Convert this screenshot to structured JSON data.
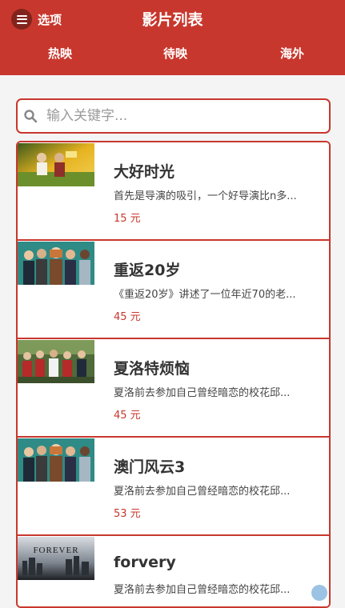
{
  "header": {
    "menu_label": "选项",
    "title": "影片列表",
    "tabs": [
      {
        "label": "热映"
      },
      {
        "label": "待映"
      },
      {
        "label": "海外"
      }
    ],
    "color": "#c8372d"
  },
  "search": {
    "placeholder": "输入关键字..."
  },
  "movies": [
    {
      "title": "大好时光",
      "desc": "首先是导演的吸引，一个好导演比n多...",
      "price": "15 元"
    },
    {
      "title": "重返20岁",
      "desc": "《重返20岁》讲述了一位年近70的老...",
      "price": "45 元"
    },
    {
      "title": "夏洛特烦恼",
      "desc": "夏洛前去参加自己曾经暗恋的校花邱...",
      "price": "45 元"
    },
    {
      "title": "澳门风云3",
      "desc": "夏洛前去参加自己曾经暗恋的校花邱...",
      "price": "53 元"
    },
    {
      "title": "forvery",
      "desc": "夏洛前去参加自己曾经暗恋的校花邱...",
      "price": ""
    }
  ],
  "poster_text": {
    "forever": "FOREVER"
  }
}
